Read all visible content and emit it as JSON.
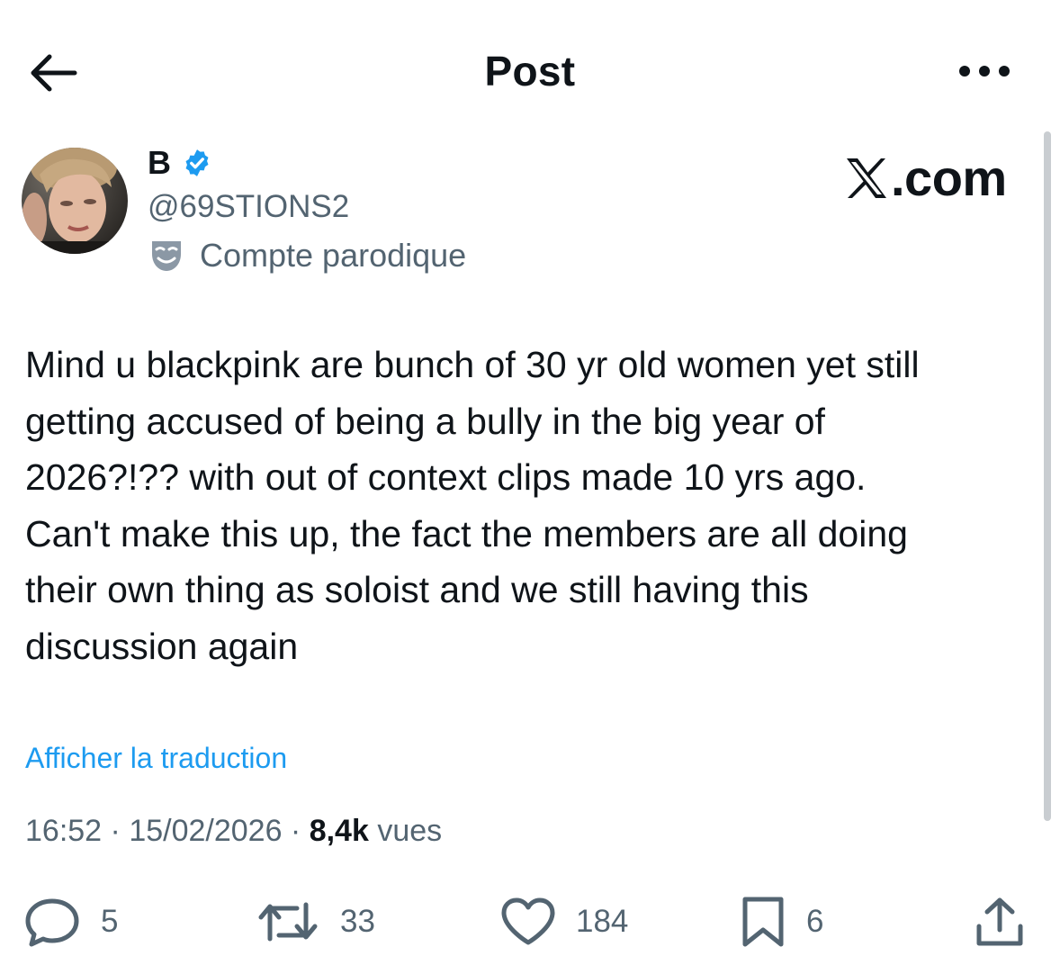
{
  "header": {
    "title": "Post",
    "back_icon": "arrow-left-icon",
    "more_icon": "more-horizontal-icon"
  },
  "author": {
    "display_name": "B",
    "verified": true,
    "handle": "@69STIONS2",
    "parody_label": "Compte parodique",
    "avatar_icon": "avatar-photo"
  },
  "watermark": {
    "text": ".com",
    "logo_letter": "X"
  },
  "post": {
    "text": "Mind u blackpink are bunch of 30 yr old women yet still\ngetting accused of being a bully in the big year of\n2026?!?? with out of context clips made 10 yrs ago.\nCan't make this up, the fact the members are all doing\ntheir own thing as soloist and we still having this\ndiscussion again",
    "translate_label": "Afficher la traduction"
  },
  "meta": {
    "time": "16:52",
    "separator": " · ",
    "date": "15/02/2026",
    "views_count": "8,4k",
    "views_label": "vues"
  },
  "actions": {
    "replies": "5",
    "reposts": "33",
    "likes": "184",
    "bookmarks": "6"
  },
  "colors": {
    "text": "#0f1419",
    "secondary": "#536471",
    "link": "#1d9bf0",
    "verified": "#1d9bf0"
  }
}
